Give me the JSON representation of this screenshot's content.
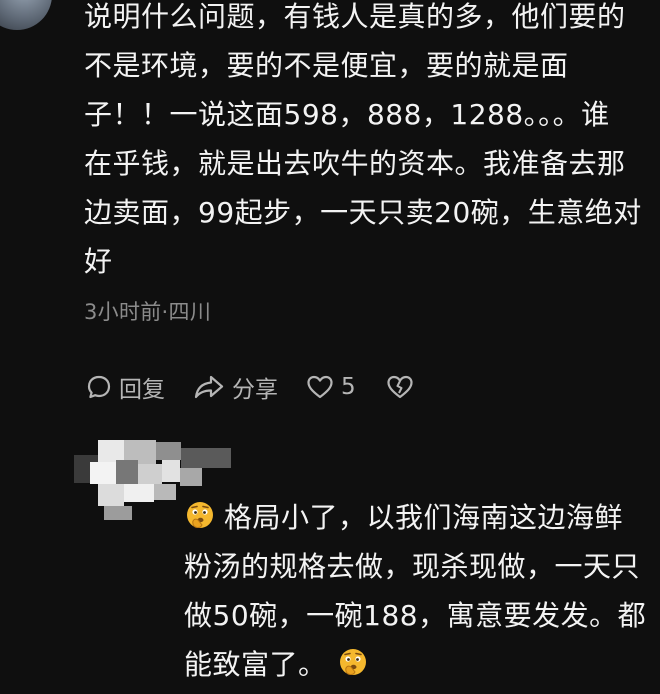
{
  "comment1": {
    "text": "说明什么问题，有钱人是真的多，他们要的不是环境，要的不是便宜，要的就是面子！！一说这面598，888，1288。。。谁在乎钱，就是出去吹牛的资本。我准备去那边卖面，99起步，一天只卖20碗，生意绝对好",
    "lines": [
      "说明什么问题，有钱人是真的多，他们要的",
      "不是环境，要的不是便宜，要的就是面",
      "子！！一说这面598，888，1288。。。谁",
      "在乎钱，就是出去吹牛的资本。我准备去那",
      "边卖面，99起步，一天只卖20碗，生意绝对",
      "好"
    ],
    "meta": "3小时前·四川",
    "actions": {
      "reply_label": "回复",
      "share_label": "分享",
      "like_count": "5"
    },
    "icons": {
      "reply": "speech-bubble-icon",
      "share": "share-arrow-icon",
      "like": "heart-icon",
      "dislike": "broken-heart-icon"
    }
  },
  "comment2": {
    "lines": [
      "格局小了，以我们海南这边海鲜",
      "粉汤的规格去做，现杀现做，一天只",
      "做50碗，一碗188，寓意要发发。都",
      "能致富了。"
    ],
    "emoji": "thinking-face-icon"
  },
  "colors": {
    "background": "#0f0f0f",
    "text": "#f3f3f3",
    "meta": "#8b8b8b",
    "action": "#b5b5b5",
    "emoji": "#f5b82e"
  }
}
